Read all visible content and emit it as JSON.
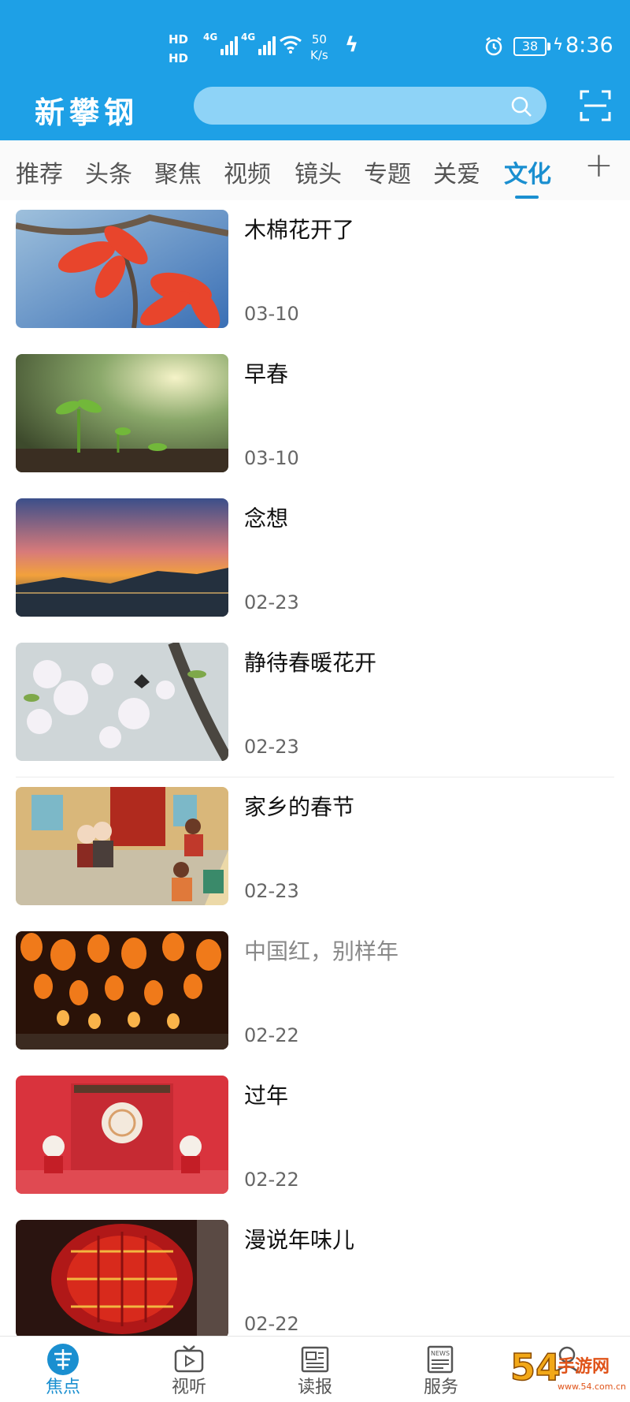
{
  "status_bar": {
    "hd1": "HD",
    "hd2": "HD",
    "sim1_net": "4G",
    "sim2_net": "4G",
    "speed_value": "50",
    "speed_unit": "K/s",
    "battery": "38",
    "time": "8:36"
  },
  "header": {
    "brand": "新攀钢",
    "search_placeholder": ""
  },
  "tabs": [
    {
      "label": "推荐"
    },
    {
      "label": "头条"
    },
    {
      "label": "聚焦"
    },
    {
      "label": "视频"
    },
    {
      "label": "镜头"
    },
    {
      "label": "专题"
    },
    {
      "label": "关爱"
    },
    {
      "label": "文化",
      "active": true
    }
  ],
  "tab_add_label": "+",
  "articles": [
    {
      "title": "木棉花开了",
      "date": "03-10"
    },
    {
      "title": "早春",
      "date": "03-10"
    },
    {
      "title": "念想",
      "date": "02-23"
    },
    {
      "title": "静待春暖花开",
      "date": "02-23"
    },
    {
      "title": "家乡的春节",
      "date": "02-23"
    },
    {
      "title": "中国红，别样年",
      "date": "02-22"
    },
    {
      "title": "过年",
      "date": "02-22"
    },
    {
      "title": "漫说年味儿",
      "date": "02-22"
    }
  ],
  "bottom_nav": [
    {
      "label": "焦点",
      "icon": "brand-logo-icon",
      "active": true
    },
    {
      "label": "视听",
      "icon": "tv-play-icon"
    },
    {
      "label": "读报",
      "icon": "newspaper-icon"
    },
    {
      "label": "服务",
      "icon": "news-icon"
    },
    {
      "label": "",
      "icon": "user-icon"
    }
  ],
  "watermark": {
    "text": "54手游网",
    "sub": "www.54.com.cn"
  },
  "colors": {
    "header_blue": "#1ea0e6",
    "accent": "#1a8fd0",
    "search_bg": "#8ed3f7"
  }
}
